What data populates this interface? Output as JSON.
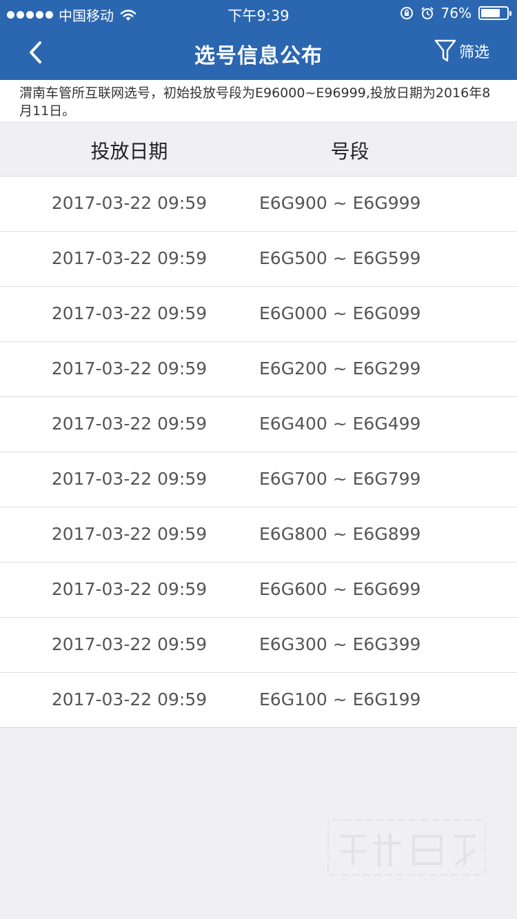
{
  "status_bar": {
    "carrier": "中国移动",
    "time": "下午9:39",
    "battery": "76%",
    "battery_level": 0.76,
    "icons": [
      "signal-dots",
      "wifi-icon",
      "orientation-lock-icon",
      "alarm-icon",
      "battery-icon"
    ]
  },
  "nav": {
    "title": "选号信息公布",
    "filter_label": "筛选",
    "back_icon": "chevron-left-icon",
    "filter_icon": "funnel-icon"
  },
  "notice": "渭南车管所互联网选号，初始投放号段为E96000~E96999,投放日期为2016年8月11日。",
  "table": {
    "headers": {
      "date": "投放日期",
      "range": "号段"
    },
    "rows": [
      {
        "date": "2017-03-22 09:59",
        "range": "E6G900 ~ E6G999"
      },
      {
        "date": "2017-03-22 09:59",
        "range": "E6G500 ~ E6G599"
      },
      {
        "date": "2017-03-22 09:59",
        "range": "E6G000 ~ E6G099"
      },
      {
        "date": "2017-03-22 09:59",
        "range": "E6G200 ~ E6G299"
      },
      {
        "date": "2017-03-22 09:59",
        "range": "E6G400 ~ E6G499"
      },
      {
        "date": "2017-03-22 09:59",
        "range": "E6G700 ~ E6G799"
      },
      {
        "date": "2017-03-22 09:59",
        "range": "E6G800 ~ E6G899"
      },
      {
        "date": "2017-03-22 09:59",
        "range": "E6G600 ~ E6G699"
      },
      {
        "date": "2017-03-22 09:59",
        "range": "E6G300 ~ E6G399"
      },
      {
        "date": "2017-03-22 09:59",
        "range": "E6G100 ~ E6G199"
      }
    ]
  },
  "colors": {
    "nav_background": "#2b67b1",
    "page_background": "#efeff4",
    "row_background": "#ffffff",
    "row_text": "#555555"
  }
}
